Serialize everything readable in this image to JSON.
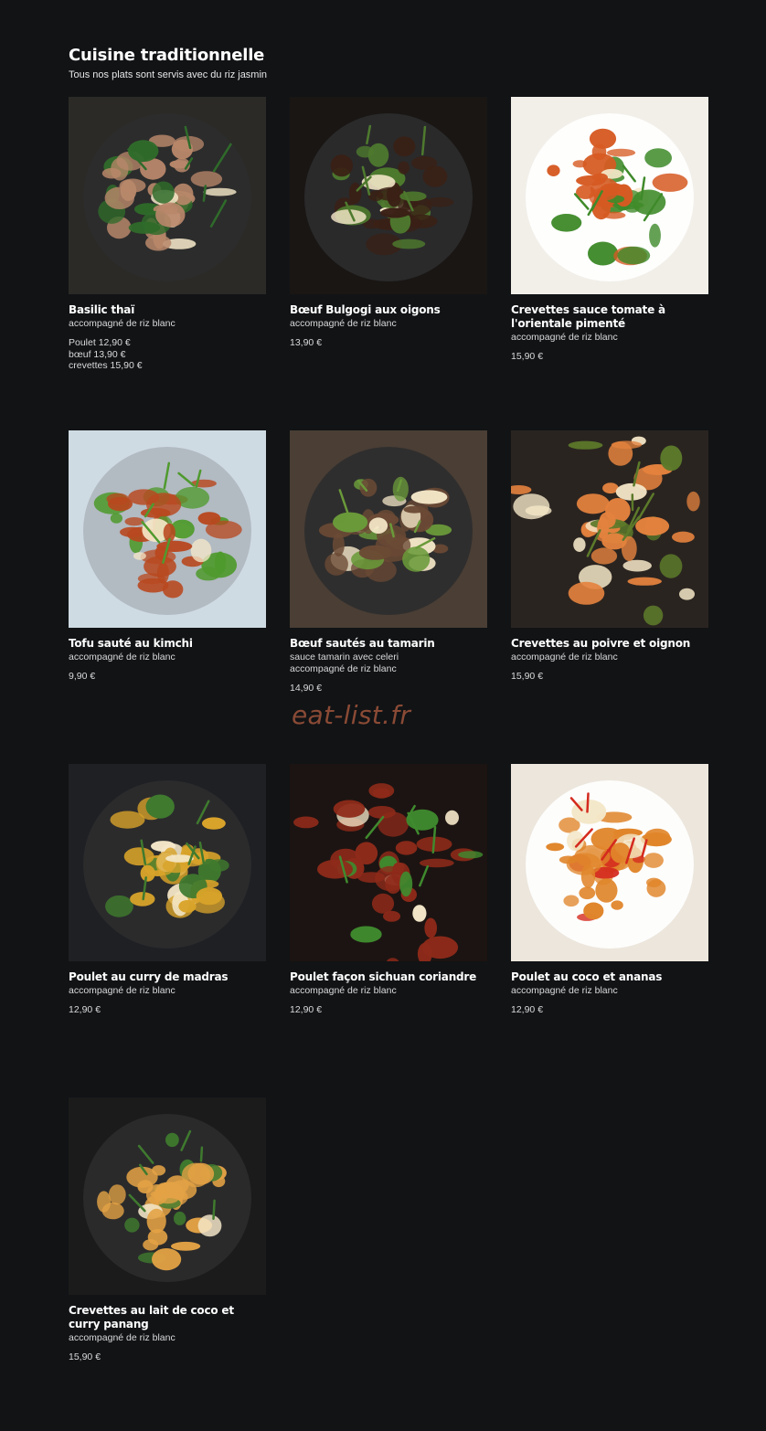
{
  "section": {
    "title": "Cuisine traditionnelle",
    "subtitle": "Tous nos plats sont servis avec du riz jasmin"
  },
  "watermark": "eat-list.fr",
  "dishes": [
    {
      "name": "Basilic thaï",
      "desc": [
        "accompagné de riz blanc"
      ],
      "prices": [
        "Poulet  12,90 €",
        "bœuf 13,90 €",
        "crevettes  15,90 €"
      ],
      "image_icon": "basil-stir-fry-photo",
      "colors": {
        "bg": "#2b2a26",
        "main": "#b8876a",
        "accent": "#2f6b2a"
      }
    },
    {
      "name": "Bœuf Bulgogi aux oigons",
      "desc": [
        "accompagné de riz blanc"
      ],
      "prices": [
        "13,90 €"
      ],
      "image_icon": "beef-bulgogi-photo",
      "colors": {
        "bg": "#1a1614",
        "main": "#3a2015",
        "accent": "#4e7a2e"
      }
    },
    {
      "name": "Crevettes sauce tomate à l'orientale pimenté",
      "desc": [
        "accompagné de riz blanc"
      ],
      "prices": [
        "15,90 €"
      ],
      "image_icon": "shrimp-tomato-sauce-photo",
      "colors": {
        "bg": "#f2efe9",
        "main": "#d65a22",
        "accent": "#3f8a2a"
      }
    },
    {
      "name": "Tofu sauté au kimchi",
      "desc": [
        "accompagné de riz blanc"
      ],
      "prices": [
        "9,90 €"
      ],
      "image_icon": "tofu-kimchi-photo",
      "colors": {
        "bg": "#cfdbe3",
        "main": "#b8481f",
        "accent": "#4f9a2e"
      }
    },
    {
      "name": "Bœuf sautés au tamarin",
      "desc": [
        "sauce tamarin avec celeri",
        "accompagné de riz blanc"
      ],
      "prices": [
        "14,90 €"
      ],
      "image_icon": "beef-tamarind-photo",
      "colors": {
        "bg": "#4a3e35",
        "main": "#6b4a35",
        "accent": "#6a9a3a"
      }
    },
    {
      "name": "Crevettes au poivre et oignon",
      "desc": [
        "accompagné de riz blanc"
      ],
      "prices": [
        "15,90 €"
      ],
      "image_icon": "pepper-shrimp-photo",
      "colors": {
        "bg": "#2a2420",
        "main": "#e3823e",
        "accent": "#5c7a2a"
      }
    },
    {
      "name": "Poulet au curry de madras",
      "desc": [
        "accompagné de riz blanc"
      ],
      "prices": [
        "12,90 €"
      ],
      "image_icon": "madras-curry-photo",
      "colors": {
        "bg": "#1e2024",
        "main": "#d8a32a",
        "accent": "#3f7a2e"
      }
    },
    {
      "name": "Poulet façon sichuan coriandre",
      "desc": [
        "accompagné de riz blanc"
      ],
      "prices": [
        "12,90 €"
      ],
      "image_icon": "sichuan-chicken-photo",
      "colors": {
        "bg": "#1c1412",
        "main": "#8e2a1a",
        "accent": "#3f8a2e"
      }
    },
    {
      "name": "Poulet au coco et ananas",
      "desc": [
        "accompagné de riz blanc"
      ],
      "prices": [
        "12,90 €"
      ],
      "image_icon": "coconut-pineapple-chicken-photo",
      "colors": {
        "bg": "#ece6dc",
        "main": "#e0852a",
        "accent": "#d42a1e"
      }
    },
    {
      "name": "Crevettes au lait de coco et curry panang",
      "desc": [
        "accompagné de riz blanc"
      ],
      "prices": [
        "15,90 €"
      ],
      "image_icon": "panang-curry-photo",
      "colors": {
        "bg": "#1b1b1b",
        "main": "#e3a245",
        "accent": "#3f7a2e"
      }
    }
  ]
}
